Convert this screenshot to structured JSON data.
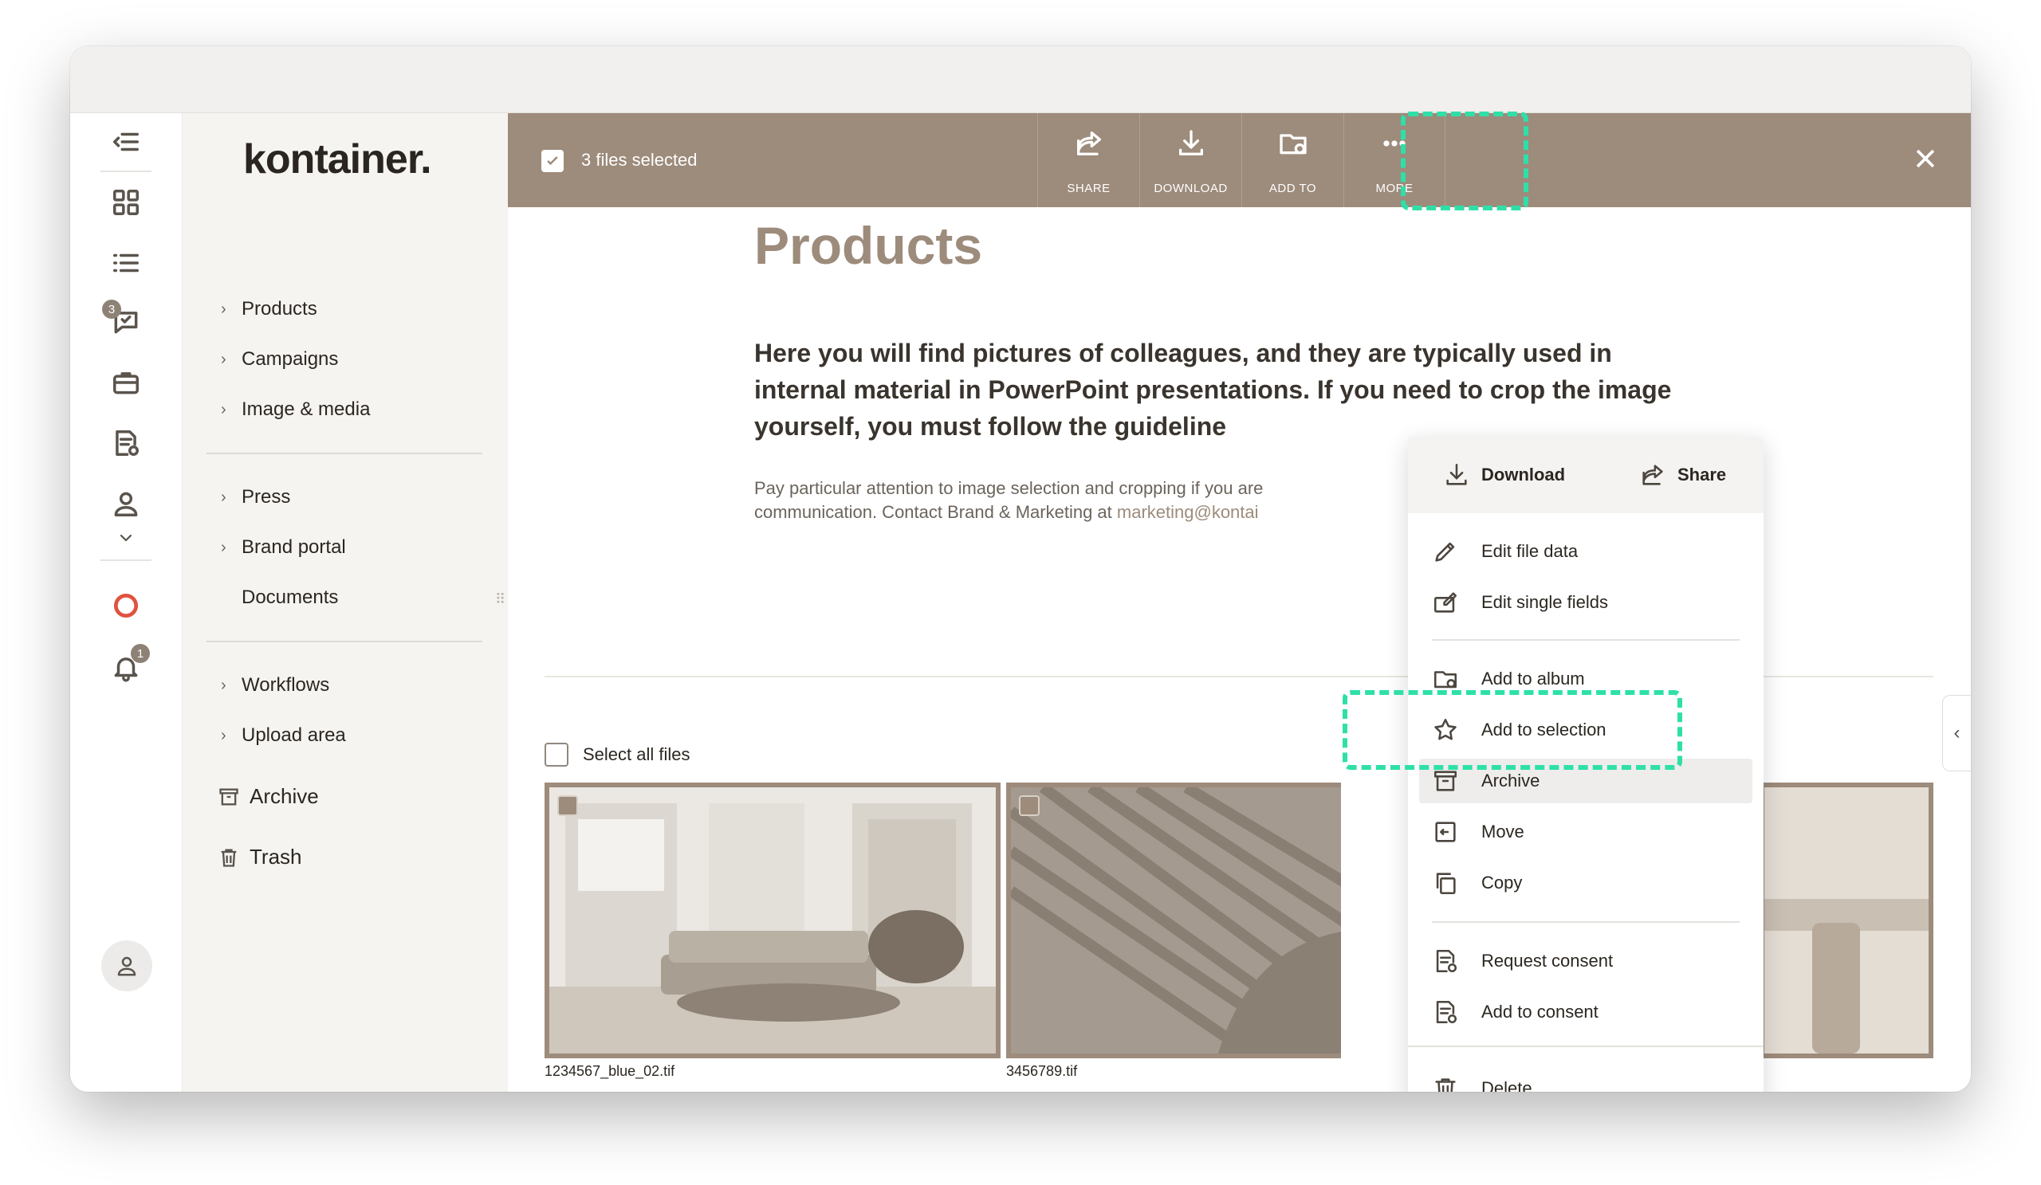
{
  "app": {
    "logo": "kontainer."
  },
  "rail": {
    "items": [
      "collapse-icon",
      "grid-icon",
      "list-icon",
      "chat-icon",
      "briefcase-icon",
      "document-check-icon",
      "user-icon",
      "chevron-down-icon",
      "lifebuoy-icon",
      "bell-icon",
      "avatar-icon"
    ],
    "chat_badge": "3",
    "bell_badge": "1"
  },
  "sidebar": {
    "groups": [
      {
        "items": [
          "Products",
          "Campaigns",
          "Image & media"
        ]
      },
      {
        "items": [
          "Press",
          "Brand portal",
          "Documents"
        ]
      },
      {
        "items": [
          "Workflows",
          "Upload area"
        ]
      }
    ],
    "archive": "Archive",
    "trash": "Trash"
  },
  "selection_bar": {
    "count_label": "3 files selected",
    "buttons": [
      {
        "label": "SHARE",
        "icon": "share-icon"
      },
      {
        "label": "DOWNLOAD",
        "icon": "download-icon"
      },
      {
        "label": "ADD TO",
        "icon": "folder-add-icon"
      },
      {
        "label": "MORE",
        "icon": "more-icon"
      }
    ]
  },
  "page": {
    "title": "Products",
    "lead": "Here you will find pictures of colleagues, and they are typically used in internal material in PowerPoint presentations. If you need to crop the image yourself, you must follow the guideline",
    "small_text": "Pay particular attention to image selection and cropping if you are",
    "small_text2": "communication. Contact Brand & Marketing at",
    "email": "marketing@kontai",
    "select_all": "Select all files"
  },
  "files": [
    {
      "name": "1234567_blue_02.tif",
      "checked": true
    },
    {
      "name": "3456789.tif",
      "checked": true
    }
  ],
  "menu": {
    "download": "Download",
    "share": "Share",
    "items": [
      {
        "label": "Edit file data",
        "icon": "pen-icon"
      },
      {
        "label": "Edit single fields",
        "icon": "edit-fields-icon"
      },
      {
        "label": "Add to album",
        "icon": "album-icon"
      },
      {
        "label": "Add to selection",
        "icon": "star-icon"
      },
      {
        "label": "Archive",
        "icon": "archive-icon"
      },
      {
        "label": "Move",
        "icon": "move-icon"
      },
      {
        "label": "Copy",
        "icon": "copy-icon"
      },
      {
        "label": "Request consent",
        "icon": "consent-request-icon"
      },
      {
        "label": "Add to consent",
        "icon": "consent-add-icon"
      },
      {
        "label": "Delete",
        "icon": "trash-icon"
      }
    ]
  },
  "colors": {
    "accent": "#9d8b7b",
    "highlight": "#2ee0a8"
  }
}
